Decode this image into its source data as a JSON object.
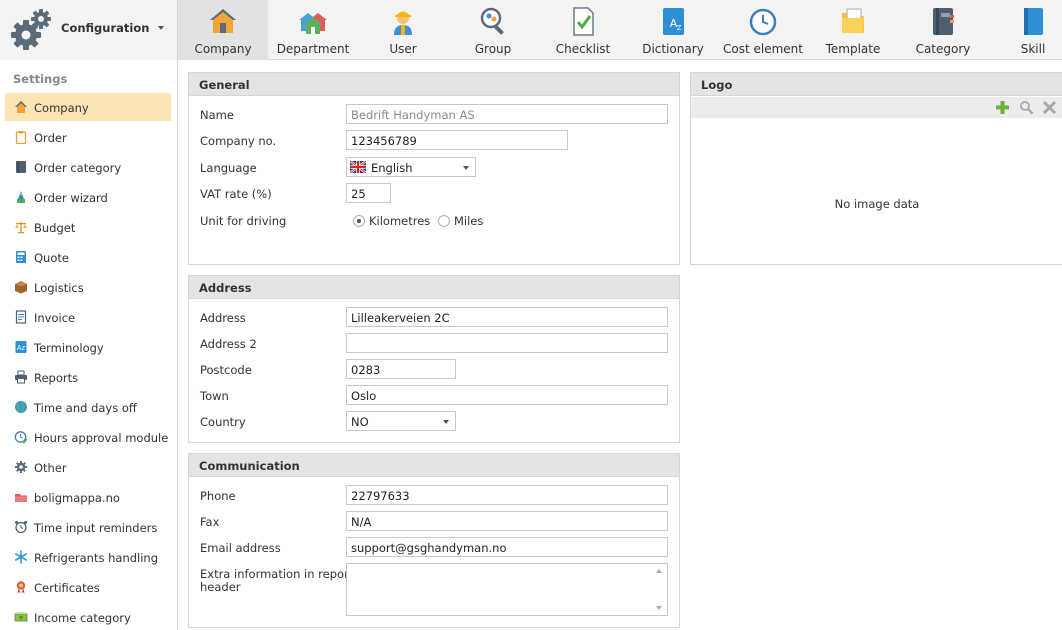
{
  "app": {
    "menu_title": "Configuration",
    "colors": {
      "active_sidebar_bg": "#fbe5b4",
      "active_ribbon_bg": "#e2e2e2",
      "panel_header_bg": "#e4e4e4",
      "add_green": "#6ab23a"
    }
  },
  "ribbon": [
    {
      "label": "Company",
      "icon": "house-icon",
      "active": true
    },
    {
      "label": "Department",
      "icon": "department-icon",
      "active": false
    },
    {
      "label": "User",
      "icon": "worker-icon",
      "active": false
    },
    {
      "label": "Group",
      "icon": "group-search-icon",
      "active": false
    },
    {
      "label": "Checklist",
      "icon": "checklist-icon",
      "active": false
    },
    {
      "label": "Dictionary",
      "icon": "dictionary-icon",
      "active": false
    },
    {
      "label": "Cost element",
      "icon": "clock-icon",
      "active": false
    },
    {
      "label": "Template",
      "icon": "template-icon",
      "active": false
    },
    {
      "label": "Category",
      "icon": "category-book-icon",
      "active": false
    },
    {
      "label": "Skill",
      "icon": "skill-book-icon",
      "active": false
    }
  ],
  "sidebar": {
    "heading": "Settings",
    "items": [
      {
        "label": "Company",
        "icon": "house-icon",
        "active": true
      },
      {
        "label": "Order",
        "icon": "clipboard-icon"
      },
      {
        "label": "Order category",
        "icon": "book-icon"
      },
      {
        "label": "Order wizard",
        "icon": "wizard-icon"
      },
      {
        "label": "Budget",
        "icon": "scales-icon"
      },
      {
        "label": "Quote",
        "icon": "calculator-icon"
      },
      {
        "label": "Logistics",
        "icon": "box-icon"
      },
      {
        "label": "Invoice",
        "icon": "invoice-icon"
      },
      {
        "label": "Terminology",
        "icon": "dictionary-icon"
      },
      {
        "label": "Reports",
        "icon": "printer-icon"
      },
      {
        "label": "Time and days off",
        "icon": "globe-icon"
      },
      {
        "label": "Hours approval module",
        "icon": "clock-check-icon"
      },
      {
        "label": "Other",
        "icon": "gear-icon"
      },
      {
        "label": "boligmappa.no",
        "icon": "boligmappa-icon"
      },
      {
        "label": "Time input reminders",
        "icon": "alarm-clock-icon"
      },
      {
        "label": "Refrigerants handling",
        "icon": "snowflake-icon"
      },
      {
        "label": "Certificates",
        "icon": "certificate-icon"
      },
      {
        "label": "Income category",
        "icon": "money-icon"
      }
    ]
  },
  "general": {
    "title": "General",
    "name_label": "Name",
    "name_value": "Bedrift Handyman AS",
    "company_no_label": "Company no.",
    "company_no_value": "123456789",
    "language_label": "Language",
    "language_value": "English",
    "vat_label": "VAT rate (%)",
    "vat_value": "25",
    "unit_label": "Unit for driving",
    "unit_options": [
      "Kilometres",
      "Miles"
    ],
    "unit_selected": "Kilometres"
  },
  "logo": {
    "title": "Logo",
    "no_data": "No image data"
  },
  "address": {
    "title": "Address",
    "address_label": "Address",
    "address_value": "Lilleakerveien 2C",
    "address2_label": "Address 2",
    "address2_value": "",
    "postcode_label": "Postcode",
    "postcode_value": "0283",
    "town_label": "Town",
    "town_value": "Oslo",
    "country_label": "Country",
    "country_value": "NO"
  },
  "communication": {
    "title": "Communication",
    "phone_label": "Phone",
    "phone_value": "22797633",
    "fax_label": "Fax",
    "fax_value": "N/A",
    "email_label": "Email address",
    "email_value": "support@gsghandyman.no",
    "extra_label_1": "Extra information in report",
    "extra_label_2": "header",
    "extra_value": ""
  }
}
